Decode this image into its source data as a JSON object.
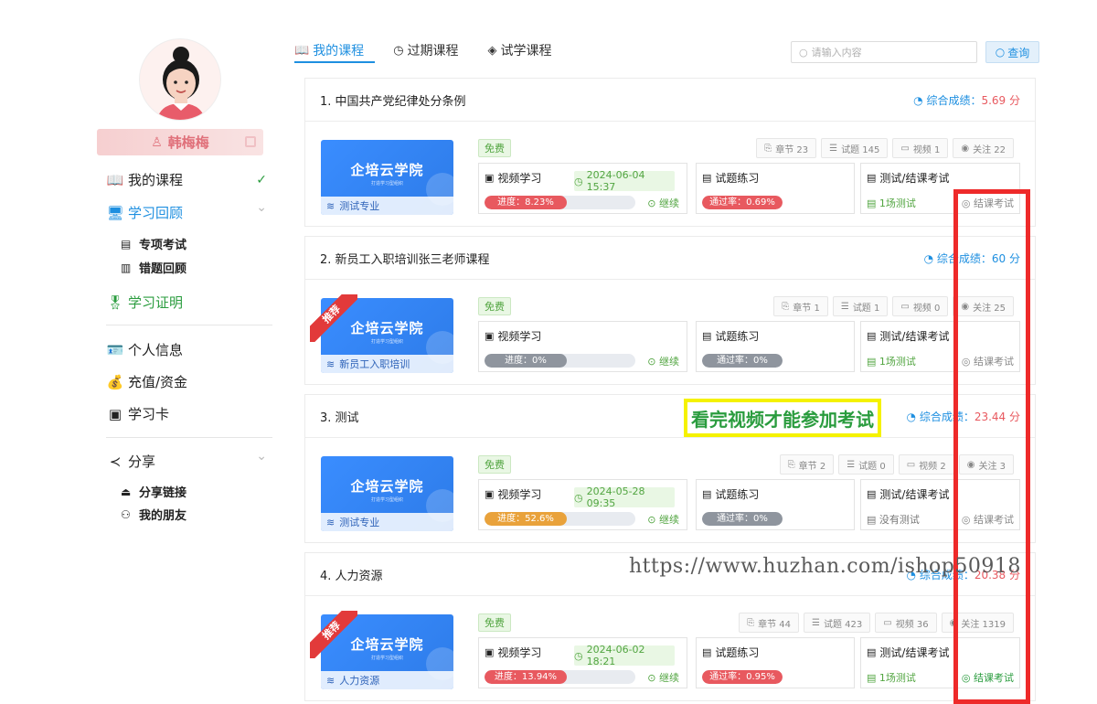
{
  "user": {
    "name": "韩梅梅"
  },
  "sidebar": {
    "items": [
      {
        "label": "我的课程",
        "icon": "book-icon",
        "mark": "✓"
      },
      {
        "label": "学习回顾",
        "icon": "monitor-icon",
        "mark": "⌄"
      },
      {
        "label": "专项考试",
        "icon": "document-icon"
      },
      {
        "label": "错题回顾",
        "icon": "notebook-icon"
      },
      {
        "label": "学习证明",
        "icon": "certificate-icon"
      },
      {
        "label": "个人信息",
        "icon": "id-card-icon"
      },
      {
        "label": "充值/资金",
        "icon": "money-bag-icon"
      },
      {
        "label": "学习卡",
        "icon": "card-icon"
      },
      {
        "label": "分享",
        "icon": "share-icon",
        "mark": "⌄"
      },
      {
        "label": "分享链接",
        "icon": "upload-icon"
      },
      {
        "label": "我的朋友",
        "icon": "friends-icon"
      }
    ]
  },
  "tabs": [
    {
      "label": "我的课程",
      "icon": "book-icon"
    },
    {
      "label": "过期课程",
      "icon": "clock-icon"
    },
    {
      "label": "试学课程",
      "icon": "badge-icon"
    }
  ],
  "search": {
    "placeholder": "请输入内容",
    "button_label": "查询"
  },
  "common": {
    "thumb_title": "企培云学院",
    "thumb_sub": "打造学习型组织",
    "free": "免费",
    "video_label": "视频学习",
    "practice_label": "试题练习",
    "exam_label": "测试/结课考试",
    "continue": "继续",
    "final_exam": "结课考试",
    "score_label": "综合成绩：",
    "recommended": "推荐"
  },
  "courses": [
    {
      "title": "1. 中国共产党纪律处分条例",
      "score": "5.69 分",
      "thumb_foot": "测试专业",
      "chapters": "章节 23",
      "questions": "试题 145",
      "videos": "视频 1",
      "follows": "关注 22",
      "date": "2024-06-04 15:37",
      "progress_text": "进度：8.23%",
      "progress": 8.23,
      "pass_text": "通过率：0.69%",
      "pass": 0.69,
      "exam_text": "1场测试",
      "recommended": false
    },
    {
      "title": "2. 新员工入职培训张三老师课程",
      "score": "60 分",
      "thumb_foot": "新员工入职培训",
      "chapters": "章节 1",
      "questions": "试题 1",
      "videos": "视频 0",
      "follows": "关注 25",
      "date": "",
      "progress_text": "进度：0%",
      "progress": 0,
      "pass_text": "通过率：0%",
      "pass": 0,
      "exam_text": "1场测试",
      "recommended": true
    },
    {
      "title": "3. 测试",
      "score": "23.44 分",
      "thumb_foot": "测试专业",
      "chapters": "章节 2",
      "questions": "试题 0",
      "videos": "视频 2",
      "follows": "关注 3",
      "date": "2024-05-28 09:35",
      "progress_text": "进度：52.6%",
      "progress": 52.6,
      "pass_text": "通过率：0%",
      "pass": 0,
      "exam_text": "没有测试",
      "recommended": false
    },
    {
      "title": "4. 人力资源",
      "score": "20.38 分",
      "thumb_foot": "人力资源",
      "chapters": "章节 44",
      "questions": "试题 423",
      "videos": "视频 36",
      "follows": "关注 1319",
      "date": "2024-06-02 18:21",
      "progress_text": "进度：13.94%",
      "progress": 13.94,
      "pass_text": "通过率：0.95%",
      "pass": 0.95,
      "exam_text": "1场测试",
      "recommended": true
    }
  ],
  "annotation": "看完视频才能参加考试",
  "watermark": "https://www.huzhan.com/ishop50918",
  "colors": {
    "accent": "#1e8fe0",
    "green": "#52a541",
    "red": "#e8595f",
    "orange": "#e9a23b",
    "gray": "#8f959e"
  }
}
